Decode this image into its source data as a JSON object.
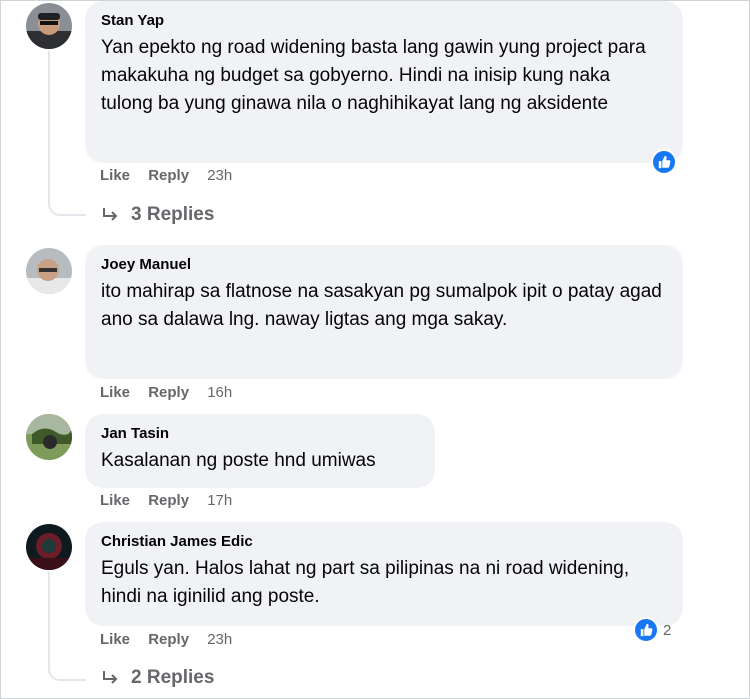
{
  "comments": [
    {
      "author": "Stan Yap",
      "text": "Yan epekto ng road widening basta lang gawin yung project para makakuha ng budget sa gobyerno. Hindi na inisip kung naka tulong ba yung ginawa nila o naghihikayat lang ng aksidente",
      "like": "Like",
      "reply": "Reply",
      "time": "23h",
      "replies": "3 Replies",
      "reaction_icon": "like-icon"
    },
    {
      "author": "Joey Manuel",
      "text": "ito mahirap sa flatnose na sasakyan pg sumalpok ipit o patay agad ano sa dalawa lng. naway ligtas ang mga sakay.",
      "like": "Like",
      "reply": "Reply",
      "time": "16h"
    },
    {
      "author": "Jan Tasin",
      "text": "Kasalanan ng poste hnd umiwas",
      "like": "Like",
      "reply": "Reply",
      "time": "17h"
    },
    {
      "author": "Christian James Edic",
      "text": "Eguls yan. Halos lahat ng part sa pilipinas na ni road widening, hindi na iginilid ang poste.",
      "like": "Like",
      "reply": "Reply",
      "time": "23h",
      "replies": "2 Replies",
      "reaction_icon": "like-icon",
      "reaction_count": "2"
    }
  ],
  "colors": {
    "bubble": "#f0f2f5",
    "meta": "#65676b",
    "accent": "#1877f2"
  }
}
